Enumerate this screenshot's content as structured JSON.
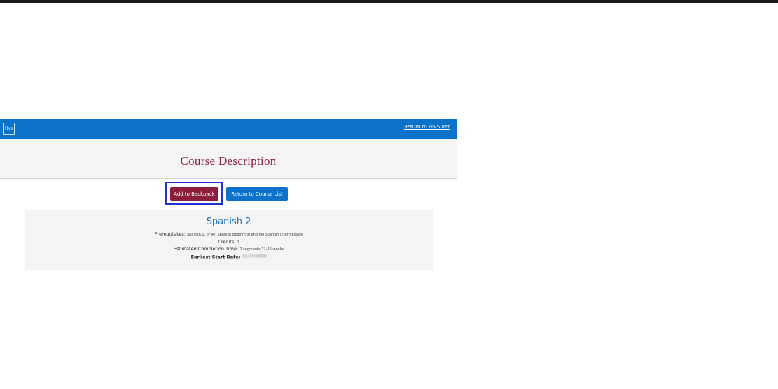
{
  "header": {
    "logo_text": "flvs",
    "return_link": "Return to FLVS.net"
  },
  "page_title": "Course Description",
  "buttons": {
    "add_to_backpack": "Add to Backpack",
    "return_to_course_list": "Return to Course List"
  },
  "course": {
    "name": "Spanish 2",
    "prerequisites_label": "Prerequisites:",
    "prerequisites_value": "Spanish 1, or M/J Spanish Beginning and M/J Spanish Intermediate",
    "credits_label": "Credits:",
    "credits_value": "1",
    "completion_label": "Estimated Completion Time:",
    "completion_value": "2 segments/32-36 weeks",
    "start_label": "Earliest Start Date:",
    "start_value": "11/17/2020"
  },
  "colors": {
    "header_blue": "#0a72c8",
    "title_maroon": "#8c1d3b",
    "highlight_box": "#2433cf"
  }
}
